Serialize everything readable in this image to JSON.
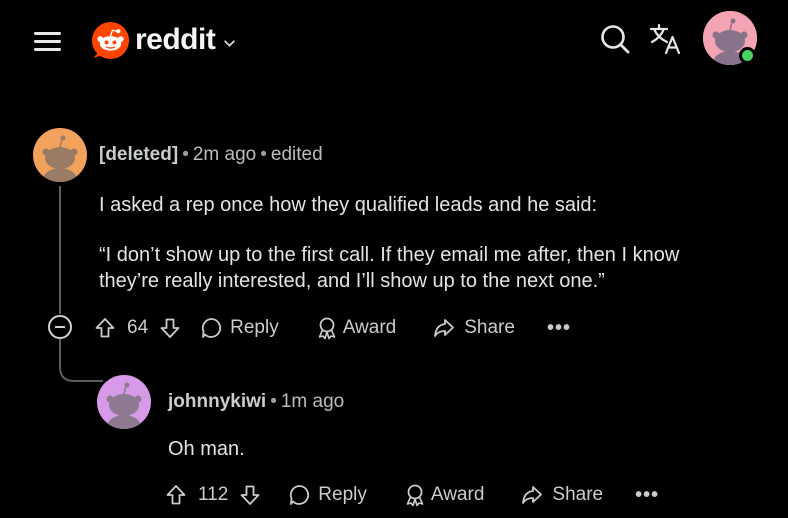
{
  "header": {
    "brand": "reddit"
  },
  "comments": [
    {
      "author": "[deleted]",
      "time": "2m ago",
      "edited": "edited",
      "body_line1": "I asked a rep once how they qualified leads and he said:",
      "body_line2": "“I don’t show up to the first call. If they email me after, then I know",
      "body_line3": "they’re really interested, and I’ll show up to the next one.”",
      "votes": "64",
      "reply_label": "Reply",
      "award_label": "Award",
      "share_label": "Share",
      "more_label": "•••",
      "avatar_color": "#f4a460"
    },
    {
      "author": "johnnykiwi",
      "time": "1m ago",
      "body": "Oh man.",
      "votes": "112",
      "reply_label": "Reply",
      "award_label": "Award",
      "share_label": "Share",
      "more_label": "•••",
      "avatar_color": "#d59ce8"
    }
  ],
  "colors": {
    "brand_orange": "#ff4500",
    "background": "#000000",
    "online": "#46d160"
  }
}
